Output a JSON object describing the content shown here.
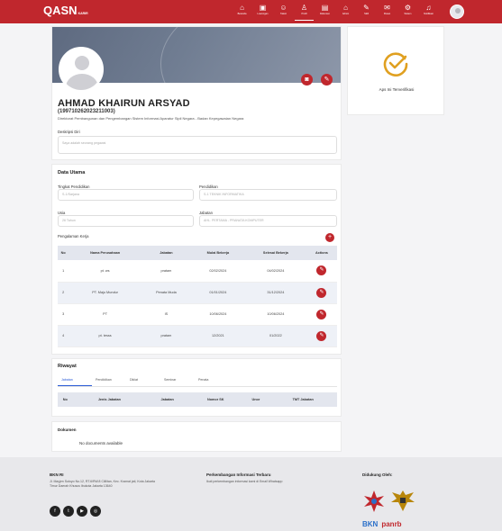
{
  "brand": {
    "logo_main": "ASN",
    "logo_sub": "KARIR",
    "accent": "#c0272d"
  },
  "nav": {
    "items": [
      {
        "label": "Beranda",
        "icon": "home-icon",
        "glyph": "⌂"
      },
      {
        "label": "Lowongan",
        "icon": "briefcase-icon",
        "glyph": "▣"
      },
      {
        "label": "Talent",
        "icon": "users-icon",
        "glyph": "☺"
      },
      {
        "label": "Profil",
        "icon": "user-icon",
        "glyph": "♙"
      },
      {
        "label": "Dokumen",
        "icon": "document-icon",
        "glyph": "▤"
      },
      {
        "label": "Admin",
        "icon": "admin-icon",
        "glyph": "⌂"
      },
      {
        "label": "Skill",
        "icon": "skill-icon",
        "glyph": "✎"
      },
      {
        "label": "Pesan",
        "icon": "chat-icon",
        "glyph": "✉"
      },
      {
        "label": "Sistem",
        "icon": "settings-icon",
        "glyph": "⚙"
      },
      {
        "label": "Notifikasi",
        "icon": "bell-icon",
        "glyph": "♫"
      }
    ]
  },
  "profile": {
    "name": "AHMAD KHAIRUN ARSYAD",
    "nip": "(199710262023211003)",
    "department": "Direktorat Pembangunan dan Pengembangan Sistem Informasi Aparatur Sipil Negara - Badan Kepegawaian Negara",
    "description_label": "Deskripsi Diri",
    "description_placeholder": "Saya adalah seorang pegawai",
    "verified_text": "Aps Ini Terverifikasi"
  },
  "data_utama": {
    "title": "Data Utama",
    "fields": {
      "tingkat_pendidikan_label": "Tingkat Pendidikan",
      "tingkat_pendidikan_value": "S-1/Sarjana",
      "pendidikan_label": "Pendidikan",
      "pendidikan_value": "S-1 TEKNIK INFORMATIKA",
      "usia_label": "Usia",
      "usia_value": "26 Tahun",
      "jabatan_label": "Jabatan",
      "jabatan_value": "AHL. PERTAMA - PRANATA KOMPUTER"
    },
    "pengalaman_label": "Pengalaman Kerja",
    "table": {
      "headers": [
        "No",
        "Nama Perusahaan",
        "Jabatan",
        "Mulai Bekerja",
        "Selesai Bekerja",
        "Actions"
      ],
      "rows": [
        {
          "no": "1",
          "perusahaan": "pt. ws",
          "jabatan": "pratam",
          "mulai": "02/02/2024",
          "selesai": "04/02/2024"
        },
        {
          "no": "2",
          "perusahaan": "PT. Maju Mundur",
          "jabatan": "Penata Muda",
          "mulai": "01/01/2024",
          "selesai": "31/12/2024"
        },
        {
          "no": "3",
          "perusahaan": "PT",
          "jabatan": "IS",
          "mulai": "10/06/2024",
          "selesai": "10/06/2024"
        },
        {
          "no": "4",
          "perusahaan": "pt. tesss",
          "jabatan": "pratam",
          "mulai": "12/2021",
          "selesai": "01/2022"
        }
      ]
    }
  },
  "riwayat": {
    "title": "Riwayat",
    "tabs": [
      "Jabatan",
      "Pendidikan",
      "Diklat",
      "Seminar",
      "Penata"
    ],
    "table_headers": [
      "No",
      "Jenis Jabatan",
      "Jabatan",
      "Nomor SK",
      "Unor",
      "TMT Jabatan"
    ]
  },
  "dokumen": {
    "title": "Dokumen",
    "empty_text": "No documents available"
  },
  "footer": {
    "col1_title": "BKN RI",
    "col1_text": "Jl. Mayjen Sutoyo No.12, RT.6/RW.8 Cililitan, Kec. Kramat jati, Kota Jakarta Timur Daerah Khusus Ibukota Jakarta 13640",
    "col2_title": "Perkembangan Informasi Terbaru",
    "col2_text": "Ikuti perkembangan informasi kami di Email Whatsapp",
    "col3_title": "Didukung Oleh:",
    "logo_bkn": "BKN",
    "logo_panrb": "panrb",
    "socials": [
      "facebook-icon",
      "twitter-icon",
      "youtube-icon",
      "instagram-icon"
    ]
  }
}
